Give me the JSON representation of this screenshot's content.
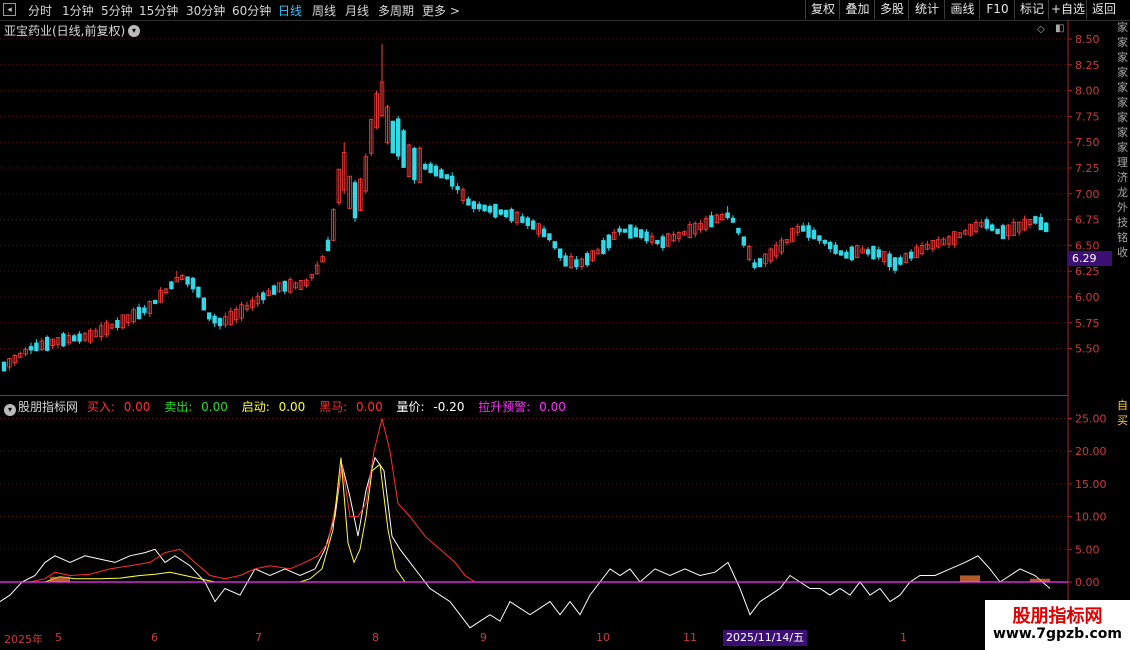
{
  "toolbar": {
    "periods": [
      "分时",
      "1分钟",
      "5分钟",
      "15分钟",
      "30分钟",
      "60分钟",
      "日线",
      "周线",
      "月线",
      "多周期",
      "更多 >"
    ],
    "active_period": "日线",
    "tools": [
      "复权",
      "叠加",
      "多股",
      "统计",
      "画线",
      "F10",
      "标记",
      "+自选",
      "返回"
    ]
  },
  "main": {
    "title": "亚宝药业(日线,前复权)",
    "price_levels": [
      "8.50",
      "8.25",
      "8.00",
      "7.75",
      "7.50",
      "7.25",
      "7.00",
      "6.75",
      "6.50",
      "6.25",
      "6.00",
      "5.75",
      "5.50"
    ],
    "current_price": "6.29"
  },
  "indicator": {
    "name": "股朋指标网",
    "buy_label": "买入:",
    "buy_value": "0.00",
    "sell_label": "卖出:",
    "sell_value": "0.00",
    "start_label": "启动:",
    "start_value": "0.00",
    "dark_horse_label": "黑马:",
    "dark_horse_value": "0.00",
    "vol_price_label": "量价:",
    "vol_price_value": "-0.20",
    "surge_label": "拉升预警:",
    "surge_value": "0.00",
    "levels": [
      "25.00",
      "20.00",
      "15.00",
      "10.00",
      "5.00",
      "0.00"
    ]
  },
  "timeline": {
    "labels": [
      "2025年",
      "5",
      "6",
      "7",
      "8",
      "9",
      "10",
      "11",
      "1"
    ],
    "highlight": "2025/11/14/五"
  },
  "right_column": {
    "chars": [
      "家",
      "家",
      "家",
      "家",
      "家",
      "家",
      "家",
      "家",
      "家",
      "理",
      "济",
      "龙",
      "外",
      "技",
      "铭",
      "收"
    ],
    "bottom_chars": [
      "自",
      "买"
    ]
  },
  "watermark": {
    "title": "股朋指标网",
    "url": "www.7gpzb.com"
  },
  "colors": {
    "up": "#ff3b3b",
    "down": "#30d8e8",
    "accent": "#2fc4ff",
    "badge": "#3b0f73",
    "buy": "#ff3030",
    "sell": "#20e020",
    "start": "#ffff40",
    "dark_horse": "#ff3030",
    "vol_price": "#ffffff",
    "surge": "#ff30ff"
  }
}
